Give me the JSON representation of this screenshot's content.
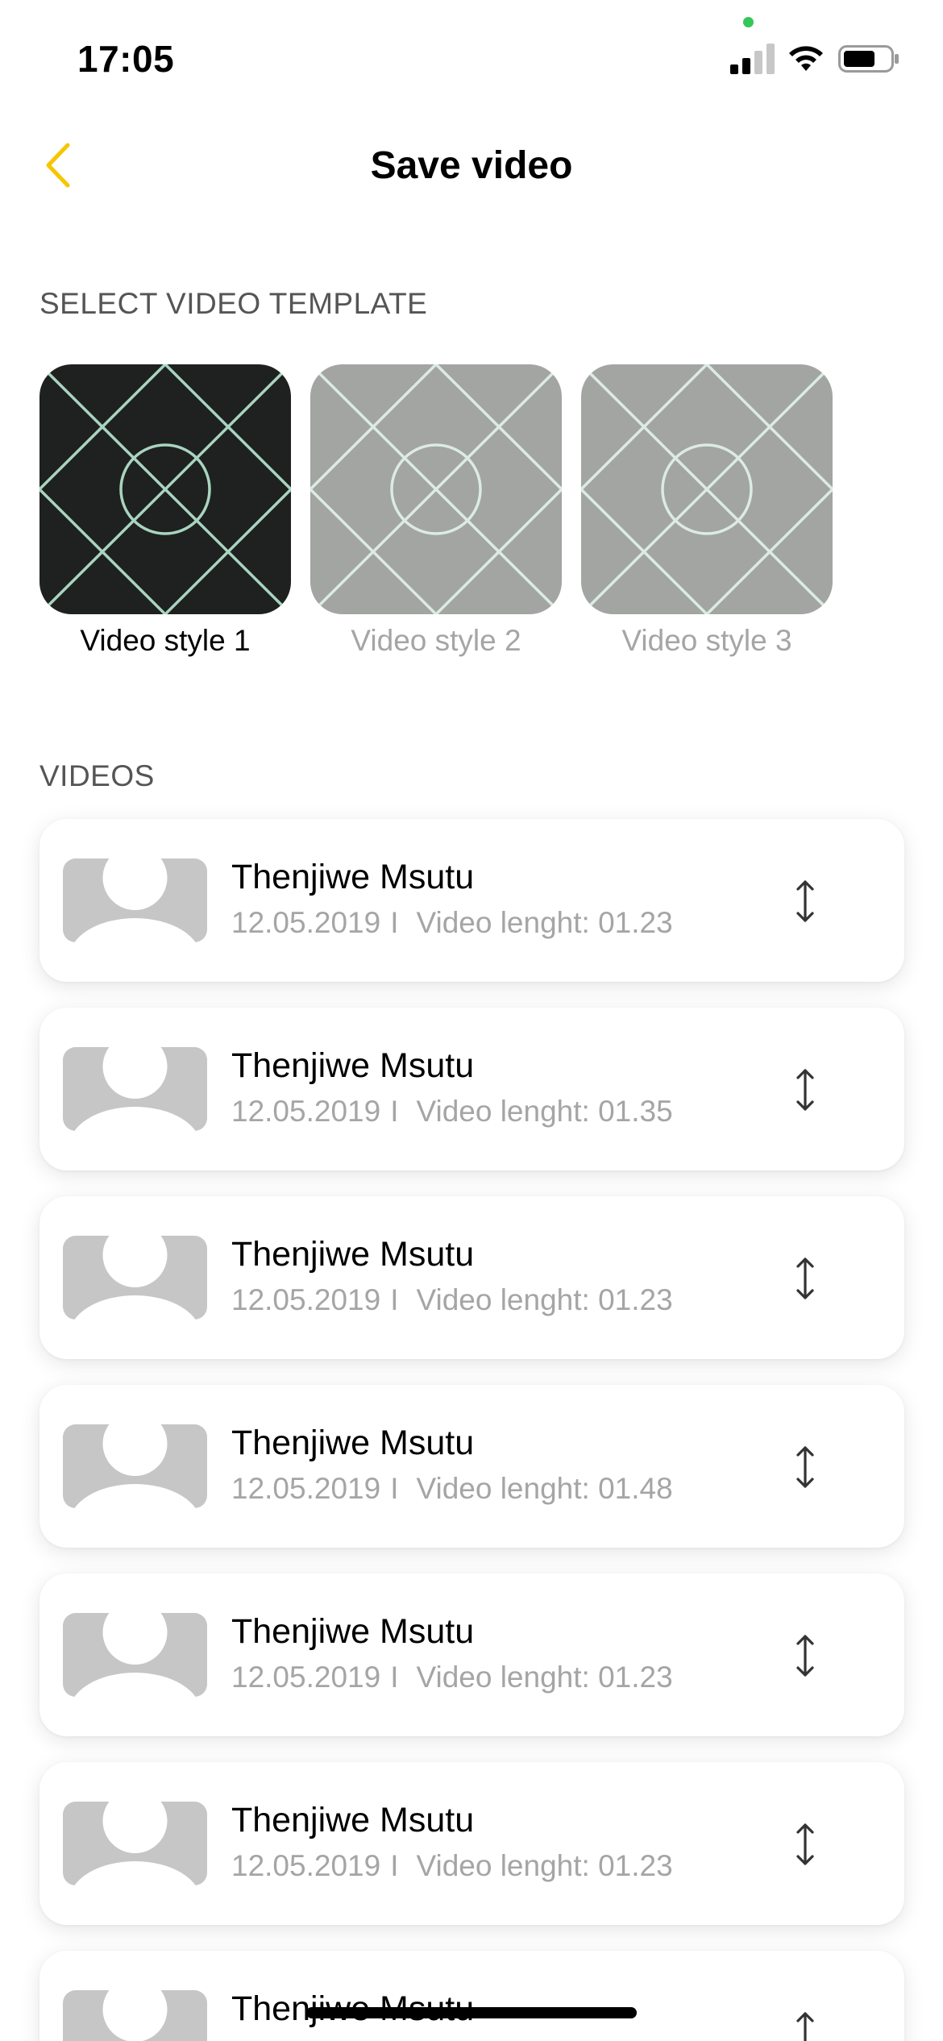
{
  "status_bar": {
    "time": "17:05"
  },
  "header": {
    "title": "Save video",
    "back_icon": "chevron-left-icon",
    "accent_color": "#f7c600"
  },
  "templates_section": {
    "label": "SELECT VIDEO TEMPLATE",
    "items": [
      {
        "label": "Video style 1",
        "selected": true
      },
      {
        "label": "Video style 2",
        "selected": false
      },
      {
        "label": "Video style 3",
        "selected": false
      }
    ]
  },
  "videos_section": {
    "label": "VIDEOS",
    "length_prefix": "Video lenght:",
    "separator": "I",
    "items": [
      {
        "name": "Thenjiwe Msutu",
        "date": "12.05.2019",
        "length": "01.23"
      },
      {
        "name": "Thenjiwe Msutu",
        "date": "12.05.2019",
        "length": "01.35"
      },
      {
        "name": "Thenjiwe Msutu",
        "date": "12.05.2019",
        "length": "01.23"
      },
      {
        "name": "Thenjiwe Msutu",
        "date": "12.05.2019",
        "length": "01.48"
      },
      {
        "name": "Thenjiwe Msutu",
        "date": "12.05.2019",
        "length": "01.23"
      },
      {
        "name": "Thenjiwe Msutu",
        "date": "12.05.2019",
        "length": "01.23"
      },
      {
        "name": "Thenjiwe Msutu",
        "date": "",
        "length": ""
      }
    ]
  }
}
